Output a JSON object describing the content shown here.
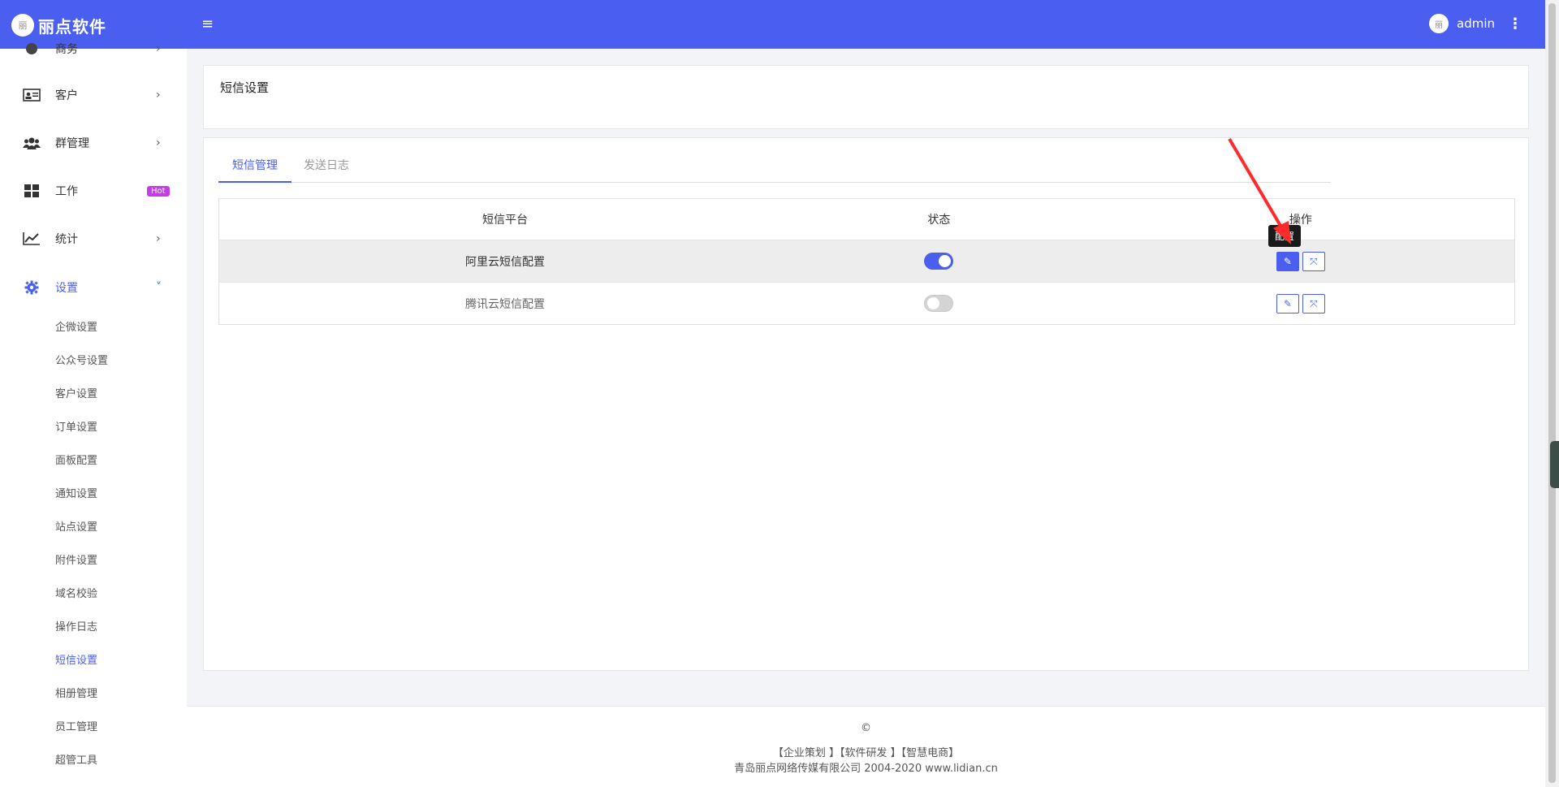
{
  "header": {
    "logo_glyph": "丽",
    "brand": "丽点软件",
    "menu_toggle_glyph": "≡",
    "avatar_glyph": "丽",
    "user": "admin",
    "more_glyph": "⋮"
  },
  "sidebar": {
    "top_partial_label": "商务",
    "items": [
      {
        "label": "客户",
        "icon": "id-card-icon",
        "chevron": "›"
      },
      {
        "label": "群管理",
        "icon": "users-icon",
        "chevron": "›"
      },
      {
        "label": "工作",
        "icon": "grid-icon",
        "badge": "Hot"
      },
      {
        "label": "统计",
        "icon": "line-chart-icon",
        "chevron": "›"
      },
      {
        "label": "设置",
        "icon": "gear-icon",
        "chevron": "˅"
      }
    ],
    "sub_items": [
      "企微设置",
      "公众号设置",
      "客户设置",
      "订单设置",
      "面板配置",
      "通知设置",
      "站点设置",
      "附件设置",
      "域名校验",
      "操作日志",
      "短信设置",
      "相册管理",
      "员工管理",
      "超管工具"
    ],
    "active_sub": "短信设置"
  },
  "page": {
    "title": "短信设置"
  },
  "tabs": [
    {
      "label": "短信管理",
      "active": true
    },
    {
      "label": "发送日志",
      "active": false
    }
  ],
  "table": {
    "headers": [
      "短信平台",
      "状态",
      "操作"
    ],
    "rows": [
      {
        "platform": "阿里云短信配置",
        "enabled": true
      },
      {
        "platform": "腾讯云短信配置",
        "enabled": false
      }
    ]
  },
  "actions": {
    "edit_glyph": "✎",
    "expand_glyph": "⤧"
  },
  "tooltip": "配置",
  "footer": {
    "copyright": "©",
    "links": "【企业策划 】【软件研发 】【智慧电商】",
    "company": "青岛丽点网络传媒有限公司 2004-2020 www.lidian.cn"
  },
  "colors": {
    "primary": "#4a5ff0",
    "hot_badge": "#c23de6",
    "arrow": "#ff2a2a"
  }
}
